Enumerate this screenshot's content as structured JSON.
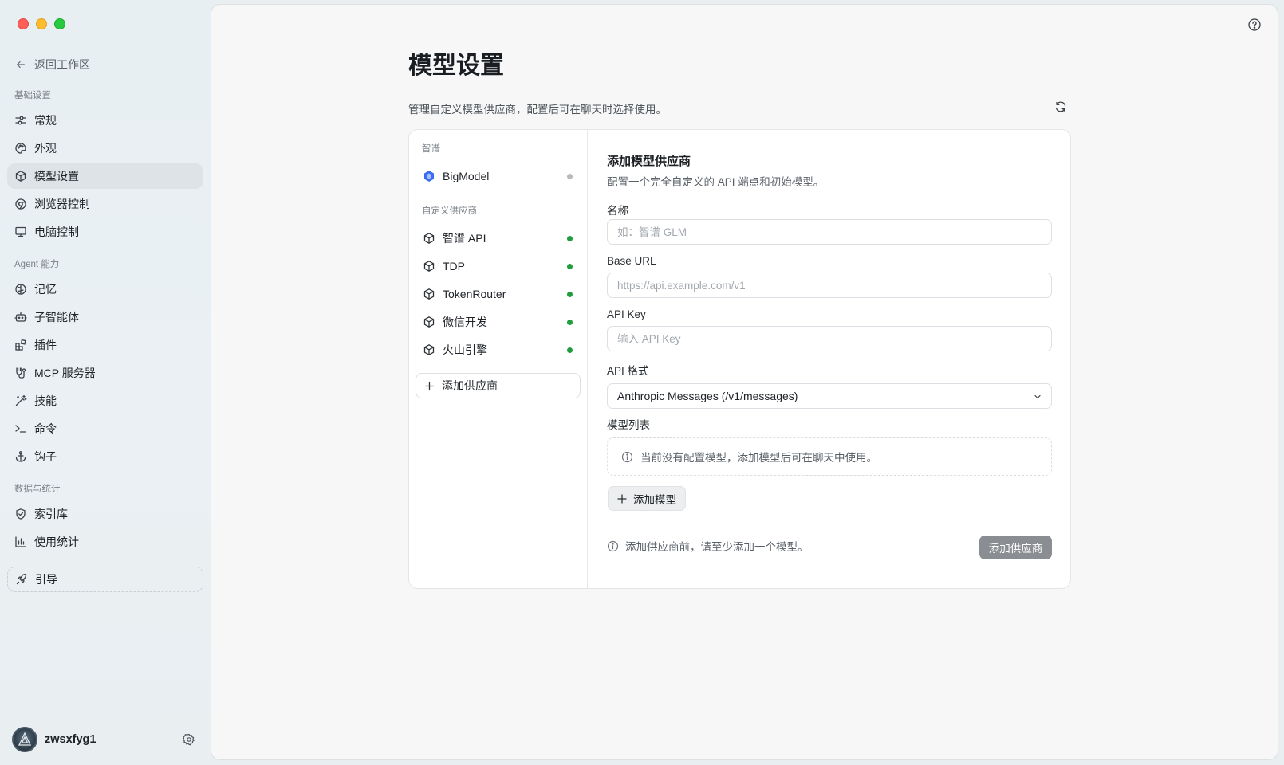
{
  "sidebar": {
    "back": "返回工作区",
    "sections": {
      "basic": "基础设置",
      "agent": "Agent 能力",
      "data": "数据与统计"
    },
    "items": {
      "general": "常规",
      "appearance": "外观",
      "model": "模型设置",
      "browser": "浏览器控制",
      "computer": "电脑控制",
      "memory": "记忆",
      "subagent": "子智能体",
      "plugins": "插件",
      "mcp": "MCP 服务器",
      "skills": "技能",
      "commands": "命令",
      "hooks": "钩子",
      "index": "索引库",
      "usage": "使用统计",
      "guide": "引导"
    },
    "user": {
      "name": "zwsxfyg1"
    }
  },
  "main": {
    "title": "模型设置",
    "description": "管理自定义模型供应商，配置后可在聊天时选择使用。"
  },
  "providers": {
    "group_builtin": "智谱",
    "group_custom": "自定义供应商",
    "builtin": [
      {
        "name": "BigModel",
        "status_color": "#b7bbbf"
      }
    ],
    "custom": [
      {
        "name": "智谱 API",
        "status_color": "#1f9d3f"
      },
      {
        "name": "TDP",
        "status_color": "#1f9d3f"
      },
      {
        "name": "TokenRouter",
        "status_color": "#1f9d3f"
      },
      {
        "name": "微信开发",
        "status_color": "#1f9d3f"
      },
      {
        "name": "火山引擎",
        "status_color": "#1f9d3f"
      }
    ],
    "add_label": "添加供应商"
  },
  "form": {
    "title": "添加模型供应商",
    "subtitle": "配置一个完全自定义的 API 端点和初始模型。",
    "name_label": "名称",
    "name_placeholder": "如：智谱 GLM",
    "base_url_label": "Base URL",
    "base_url_placeholder": "https://api.example.com/v1",
    "api_key_label": "API Key",
    "api_key_placeholder": "输入 API Key",
    "format_label": "API 格式",
    "format_value": "Anthropic Messages (/v1/messages)",
    "models_label": "模型列表",
    "models_empty": "当前没有配置模型，添加模型后可在聊天中使用。",
    "add_model": "添加模型",
    "footer_note": "添加供应商前，请至少添加一个模型。",
    "submit": "添加供应商"
  },
  "colors": {
    "accent_active": "#dde3e7",
    "status_ok": "#1f9d3f",
    "status_idle": "#b7bbbf",
    "submit_disabled": "#8a8d91",
    "bigmodel_brand": "#3b6cf5"
  }
}
